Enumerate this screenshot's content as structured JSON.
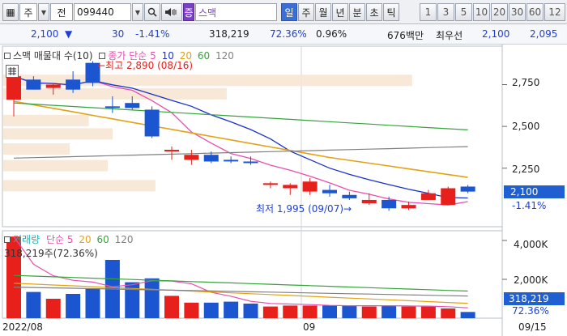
{
  "toolbar": {
    "market_icon": "▦",
    "market": "주",
    "search_label": "전",
    "code": "099440",
    "search_icon": "🔍",
    "speaker_icon": "speaker-icon",
    "tag": "증",
    "name": "스맥",
    "period_tabs": [
      "일",
      "주",
      "월",
      "년",
      "분",
      "초",
      "틱"
    ],
    "active_tab": "일",
    "interval_buttons": [
      "1",
      "3",
      "5",
      "10",
      "20",
      "30",
      "60",
      "12"
    ]
  },
  "info": {
    "price": "2,100",
    "down_arrow": "▼",
    "change": "30",
    "change_pct": "-1.41%",
    "volume": "318,219",
    "volume_ratio": "72.36%",
    "turnover_rate": "0.96%",
    "amount": "676백만",
    "quote_label": "최우선",
    "bid": "2,100",
    "ask": "2,095"
  },
  "chart": {
    "price_legend": {
      "name": "스맥 매물대 수(10)",
      "sma_label": "종가 단순",
      "periods": [
        "5",
        "10",
        "20",
        "60",
        "120"
      ]
    },
    "volume_legend": {
      "name": "거래량",
      "sma_label": "단순",
      "periods": [
        "5",
        "20",
        "60",
        "120"
      ],
      "value": "318,219주(72.36%)"
    },
    "annotations": {
      "high": "←최고 2,890 (08/16)",
      "low": "최저 1,995 (09/07)→"
    },
    "price_ticks": [
      "2,750",
      "2,500",
      "2,250"
    ],
    "volume_ticks": [
      "4,000K",
      "2,000K"
    ],
    "date_labels": [
      "2022/08",
      "09",
      "09/15"
    ],
    "price_tag": {
      "value": "2,100",
      "change": "-1.41%"
    },
    "volume_tag": {
      "value": "318,219",
      "ratio": "72.36%"
    },
    "colors": {
      "up": "#e8201c",
      "down": "#1c55d0",
      "sma5": "#e84fb0",
      "sma10": "#1a32c8",
      "sma20": "#e2a214",
      "sma60": "#34a43a",
      "sma120": "#808080",
      "volume_profile": "#f7e6d4"
    }
  },
  "chart_data": {
    "type": "candlestick",
    "dates": [
      "2022/08",
      "09",
      "09/15"
    ],
    "candles": [
      {
        "open": 2660,
        "high": 2790,
        "low": 2560,
        "close": 2800,
        "dir": "up"
      },
      {
        "open": 2780,
        "high": 2800,
        "low": 2720,
        "close": 2720,
        "dir": "down"
      },
      {
        "open": 2730,
        "high": 2760,
        "low": 2690,
        "close": 2750,
        "dir": "up"
      },
      {
        "open": 2780,
        "high": 2830,
        "low": 2700,
        "close": 2720,
        "dir": "down"
      },
      {
        "open": 2760,
        "high": 2890,
        "low": 2740,
        "close": 2880,
        "dir": "down"
      },
      {
        "open": 2620,
        "high": 2680,
        "low": 2580,
        "close": 2620,
        "dir": "down"
      },
      {
        "open": 2640,
        "high": 2680,
        "low": 2600,
        "close": 2610,
        "dir": "down"
      },
      {
        "open": 2600,
        "high": 2620,
        "low": 2430,
        "close": 2440,
        "dir": "down"
      },
      {
        "open": 2350,
        "high": 2380,
        "low": 2300,
        "close": 2360,
        "dir": "up"
      },
      {
        "open": 2330,
        "high": 2360,
        "low": 2270,
        "close": 2300,
        "dir": "up"
      },
      {
        "open": 2330,
        "high": 2350,
        "low": 2280,
        "close": 2290,
        "dir": "down"
      },
      {
        "open": 2300,
        "high": 2320,
        "low": 2280,
        "close": 2300,
        "dir": "down"
      },
      {
        "open": 2290,
        "high": 2320,
        "low": 2270,
        "close": 2290,
        "dir": "down"
      },
      {
        "open": 2150,
        "high": 2170,
        "low": 2130,
        "close": 2160,
        "dir": "up"
      },
      {
        "open": 2130,
        "high": 2160,
        "low": 2090,
        "close": 2150,
        "dir": "up"
      },
      {
        "open": 2170,
        "high": 2190,
        "low": 2090,
        "close": 2110,
        "dir": "up"
      },
      {
        "open": 2120,
        "high": 2150,
        "low": 2080,
        "close": 2100,
        "dir": "down"
      },
      {
        "open": 2090,
        "high": 2110,
        "low": 2060,
        "close": 2070,
        "dir": "down"
      },
      {
        "open": 2060,
        "high": 2100,
        "low": 2030,
        "close": 2040,
        "dir": "up"
      },
      {
        "open": 2060,
        "high": 2080,
        "low": 1995,
        "close": 2010,
        "dir": "down"
      },
      {
        "open": 2030,
        "high": 2050,
        "low": 2000,
        "close": 2010,
        "dir": "up"
      },
      {
        "open": 2100,
        "high": 2120,
        "low": 2060,
        "close": 2060,
        "dir": "up"
      },
      {
        "open": 2130,
        "high": 2140,
        "low": 2030,
        "close": 2030,
        "dir": "up"
      },
      {
        "open": 2110,
        "high": 2150,
        "low": 2100,
        "close": 2140,
        "dir": "down"
      }
    ],
    "volume_k": [
      4200,
      1350,
      1000,
      1250,
      1500,
      3000,
      1850,
      2050,
      1150,
      800,
      800,
      850,
      750,
      600,
      650,
      650,
      650,
      650,
      600,
      650,
      600,
      600,
      500,
      320
    ],
    "volume_profile_widths": [
      0.86,
      0.47,
      0.18,
      0.23,
      0.14,
      0.22,
      0.32
    ]
  }
}
